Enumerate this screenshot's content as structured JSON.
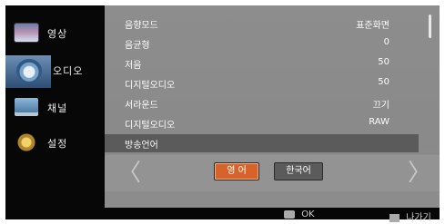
{
  "sidebar": {
    "items": [
      {
        "label": "영상",
        "icon": "picture-icon"
      },
      {
        "label": "오디오",
        "icon": "audio-icon"
      },
      {
        "label": "채널",
        "icon": "channel-icon"
      },
      {
        "label": "설정",
        "icon": "settings-icon"
      }
    ]
  },
  "menu": {
    "rows": [
      {
        "label": "음향모드",
        "value": "표준화면"
      },
      {
        "label": "음균형",
        "value": "0"
      },
      {
        "label": "저음",
        "value": "50"
      },
      {
        "label": "디지털오디오",
        "value": "50"
      },
      {
        "label": "서라운드",
        "value": "끄기"
      },
      {
        "label": "디지털오디오",
        "value": "RAW"
      },
      {
        "label": "방송언어",
        "value": ""
      }
    ]
  },
  "language": {
    "left_arrow": "〈",
    "right_arrow": "〉",
    "option_en": "영 어",
    "option_ko": "한국어"
  },
  "footer": {
    "ok_label": "OK",
    "back_label": "나가기"
  },
  "colors": {
    "accent": "#d7622a",
    "panel": "#8d8d8d",
    "highlight": "#5b5b5b",
    "frame": "#0a0a0a"
  }
}
